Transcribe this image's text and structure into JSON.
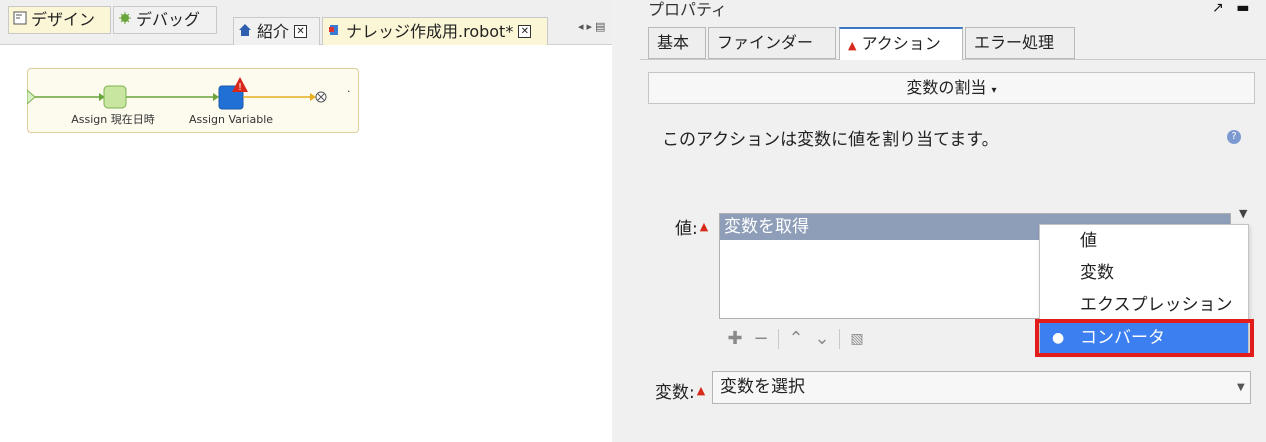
{
  "left": {
    "modes": {
      "design_label": "デザイン",
      "debug_label": "デバッグ"
    },
    "tabs": {
      "intro_label": "紹介",
      "robot_label": "ナレッジ作成用.robot*"
    },
    "flow": {
      "step1_label": "Assign 現在日時",
      "step2_label": "Assign Variable",
      "end_mark": "·"
    }
  },
  "properties": {
    "title": "プロパティ",
    "tabs": [
      "基本",
      "ファインダー",
      "アクション",
      "エラー処理"
    ],
    "action_select": "変数の割当",
    "description": "このアクションは変数に値を割り当てます。",
    "value_label": "値:",
    "value_row": "変数を取得",
    "variable_label": "変数:",
    "variable_placeholder": "変数を選択",
    "popup_items": [
      "値",
      "変数",
      "エクスプレッション",
      "コンバータ"
    ],
    "selected_popup_item": "コンバータ"
  },
  "colors": {
    "selected_menu": "#3c7ff0",
    "highlight": "#e21b1b",
    "warning": "#d7291c",
    "value_row": "#8e9eb9"
  },
  "icons": [
    "design-icon",
    "debug-icon",
    "home-icon",
    "robot-icon",
    "warning-icon",
    "help-icon",
    "add-icon",
    "remove-icon",
    "move-up-icon",
    "move-down-icon",
    "edit-icon"
  ]
}
